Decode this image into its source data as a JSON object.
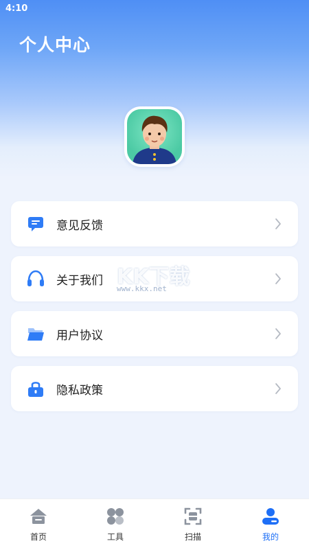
{
  "status_bar": {
    "time": "4:10"
  },
  "header": {
    "title": "个人中心"
  },
  "menu": {
    "items": [
      {
        "label": "意见反馈",
        "icon": "feedback-icon"
      },
      {
        "label": "关于我们",
        "icon": "headphones-icon"
      },
      {
        "label": "用户协议",
        "icon": "folder-icon"
      },
      {
        "label": "隐私政策",
        "icon": "lock-icon"
      }
    ]
  },
  "watermark": {
    "text": "KK下载",
    "url": "www.kkx.net"
  },
  "tab_bar": {
    "tabs": [
      {
        "label": "首页",
        "icon": "home-icon"
      },
      {
        "label": "工具",
        "icon": "grid-icon"
      },
      {
        "label": "扫描",
        "icon": "scan-icon"
      },
      {
        "label": "我的",
        "icon": "person-icon",
        "active": true
      }
    ]
  },
  "colors": {
    "accent": "#1e6ff6",
    "icon_blue": "#2f7cf6",
    "icon_gray": "#8c939e"
  }
}
